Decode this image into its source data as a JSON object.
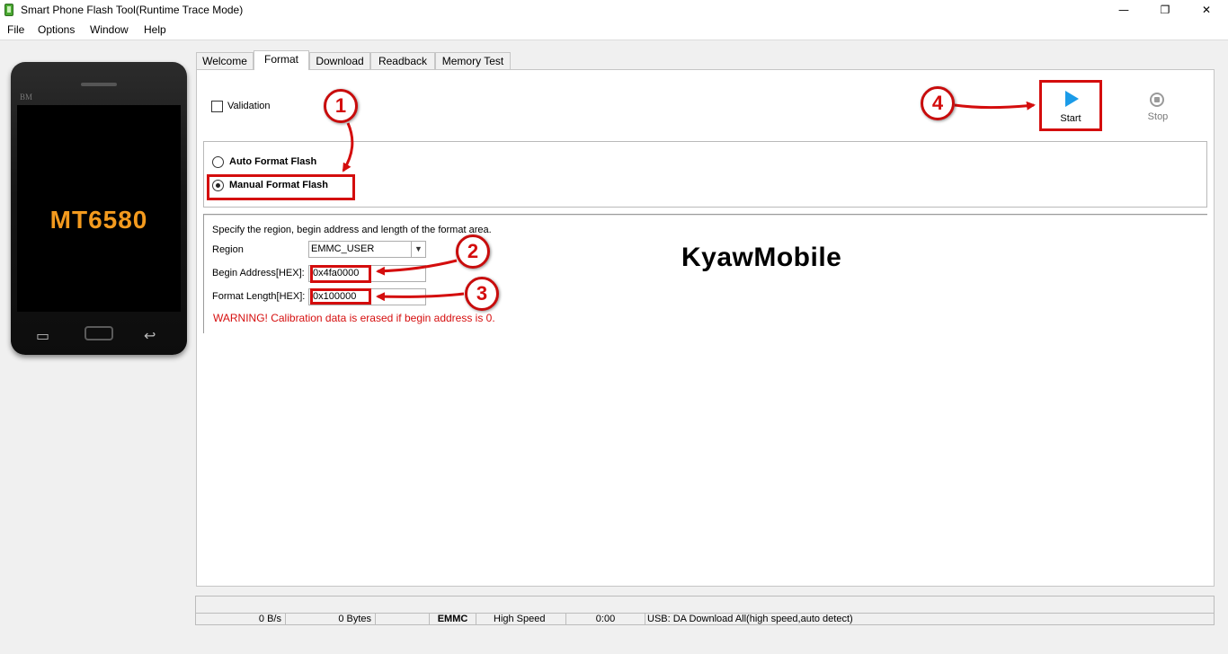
{
  "window": {
    "title": "Smart Phone Flash Tool(Runtime Trace Mode)",
    "minimize_glyph": "—",
    "maximize_glyph": "❐",
    "close_glyph": "✕"
  },
  "menu": {
    "file": "File",
    "options": "Options",
    "window": "Window",
    "help": "Help"
  },
  "phone": {
    "brand": "BM",
    "model": "MT6580",
    "menu_key_glyph": "▭",
    "back_key_glyph": "↩"
  },
  "tabs": {
    "welcome": "Welcome",
    "format": "Format",
    "download": "Download",
    "readback": "Readback",
    "memory_test": "Memory Test",
    "active": "Format"
  },
  "format": {
    "validation_label": "Validation",
    "validation_checked": false,
    "start_label": "Start",
    "stop_label": "Stop",
    "auto_format_label": "Auto Format Flash",
    "manual_format_label": "Manual Format Flash",
    "selected_mode": "Manual Format Flash",
    "spec_text": "Specify the region, begin address and length of the format area.",
    "region_label": "Region",
    "region_value": "EMMC_USER",
    "begin_address_label": "Begin Address[HEX]:",
    "begin_address_value": "0x4fa0000",
    "format_length_label": "Format Length[HEX]:",
    "format_length_value": "0x100000",
    "warning": "WARNING! Calibration data is erased if begin address is 0."
  },
  "watermark": "KyawMobile",
  "annotations": {
    "step1": "1",
    "step2": "2",
    "step3": "3",
    "step4": "4"
  },
  "status": {
    "speed": "0 B/s",
    "bytes": "0 Bytes",
    "empty": "",
    "storage": "EMMC",
    "mode": "High Speed",
    "time": "0:00",
    "usb": "USB: DA Download All(high speed,auto detect)"
  },
  "colors": {
    "highlight_red": "#d40d0d",
    "warning_red": "#d60f0f",
    "play_blue": "#1b9be8",
    "model_orange": "#f39a1e"
  }
}
